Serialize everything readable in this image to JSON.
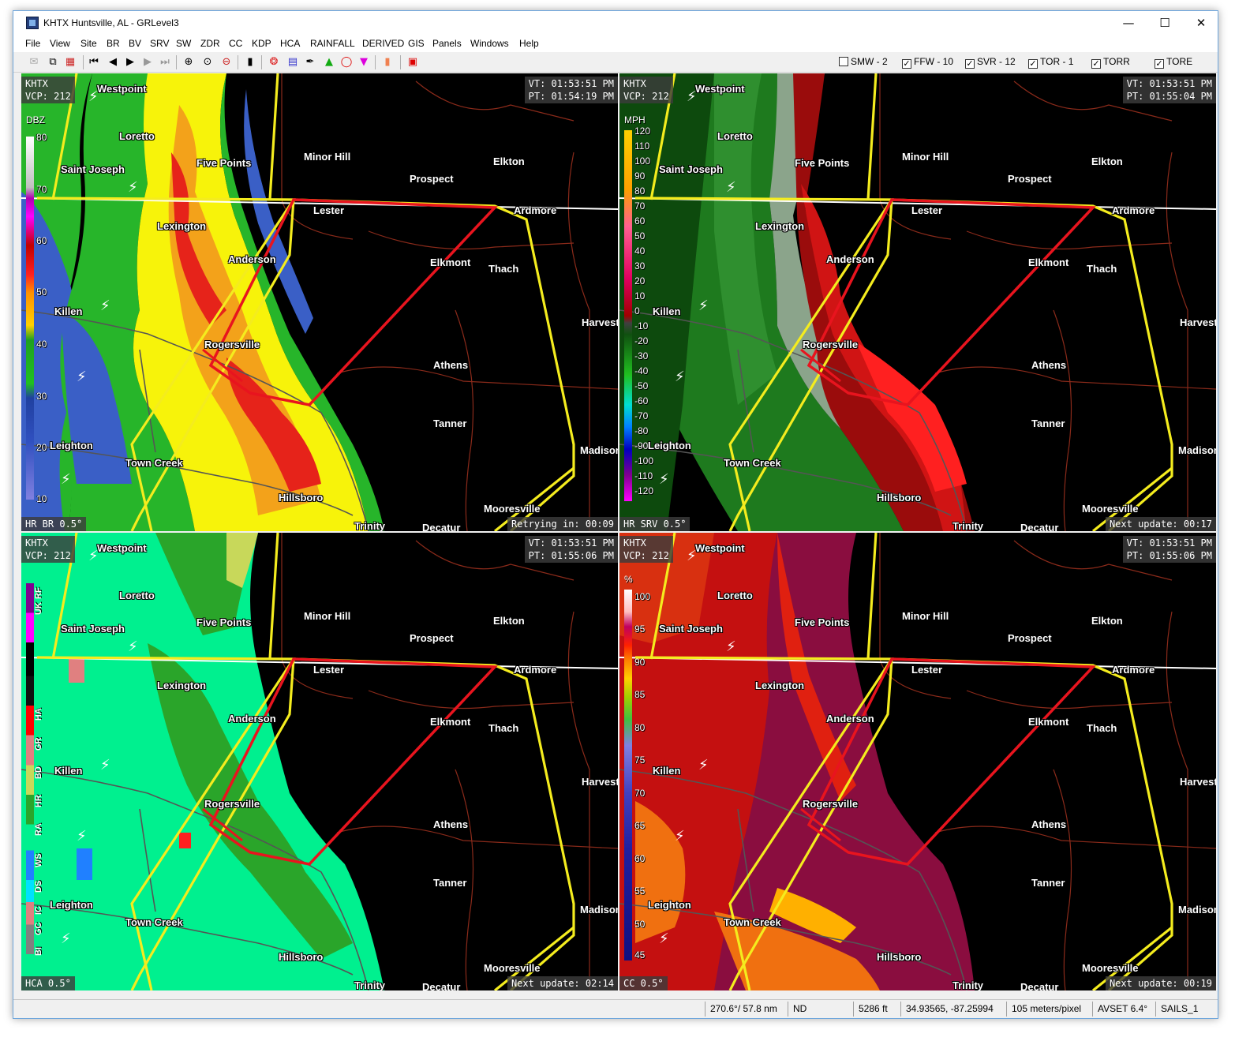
{
  "window": {
    "title": "KHTX Huntsville, AL - GRLevel3"
  },
  "menu": [
    "File",
    "View",
    "Site",
    "BR",
    "BV",
    "SRV",
    "SW",
    "ZDR",
    "CC",
    "KDP",
    "HCA",
    "RAINFALL",
    "DERIVED",
    "GIS",
    "Panels",
    "Windows",
    "Help"
  ],
  "warnings": [
    {
      "label": "SMW - 2",
      "checked": false
    },
    {
      "label": "FFW - 10",
      "checked": true
    },
    {
      "label": "SVR - 12",
      "checked": true
    },
    {
      "label": "TOR - 1",
      "checked": true
    },
    {
      "label": "TORR",
      "checked": true
    },
    {
      "label": "TORE",
      "checked": true
    }
  ],
  "panels": [
    {
      "site": "KHTX",
      "vcp": "VCP: 212",
      "vt": "VT: 01:53:51 PM",
      "pt": "PT: 01:54:19 PM",
      "product": "HR BR 0.5°",
      "status": "Retrying in: 00:09",
      "unit": "DBZ",
      "legend_ticks": [
        "80",
        "70",
        "60",
        "50",
        "40",
        "30",
        "20",
        "10"
      ]
    },
    {
      "site": "KHTX",
      "vcp": "VCP: 212",
      "vt": "VT: 01:53:51 PM",
      "pt": "PT: 01:55:04 PM",
      "product": "HR SRV 0.5°",
      "status": "Next update: 00:17",
      "unit": "MPH",
      "legend_ticks": [
        "120",
        "110",
        "100",
        "90",
        "80",
        "70",
        "60",
        "50",
        "40",
        "30",
        "20",
        "10",
        "0",
        "-10",
        "-20",
        "-30",
        "-40",
        "-50",
        "-60",
        "-70",
        "-80",
        "-90",
        "-100",
        "-110",
        "-120"
      ]
    },
    {
      "site": "KHTX",
      "vcp": "VCP: 212",
      "vt": "VT: 01:53:51 PM",
      "pt": "PT: 01:55:06 PM",
      "product": "HCA 0.5°",
      "status": "Next update: 02:14",
      "unit": "",
      "legend_ticks": [
        "UK",
        "RF",
        "HA",
        "GR",
        "BD",
        "HR",
        "RA",
        "WS",
        "DS",
        "IC",
        "GC",
        "BI"
      ]
    },
    {
      "site": "KHTX",
      "vcp": "VCP: 212",
      "vt": "VT: 01:53:51 PM",
      "pt": "PT: 01:55:06 PM",
      "product": "CC 0.5°",
      "status": "Next update: 00:19",
      "unit": "%",
      "legend_ticks": [
        "100",
        "95",
        "90",
        "85",
        "80",
        "75",
        "70",
        "65",
        "60",
        "55",
        "50",
        "45"
      ]
    }
  ],
  "places": [
    "Westpoint",
    "Loretto",
    "Saint Joseph",
    "Five Points",
    "Minor Hill",
    "Prospect",
    "Elkton",
    "Lester",
    "Ardmore",
    "Lexington",
    "Anderson",
    "Elkmont",
    "Thach",
    "Killen",
    "Rogersville",
    "Athens",
    "Harvest",
    "Tanner",
    "Leighton",
    "Town Creek",
    "Madison",
    "Hillsboro",
    "Mooresville",
    "Trinity",
    "Decatur"
  ],
  "status_bar": {
    "azimuth": "270.6°/ 57.8 nm",
    "value": "ND",
    "height": "5286 ft",
    "latlon": "34.93565, -87.25994",
    "resolution": "105 meters/pixel",
    "avset": "AVSET 6.4°",
    "sails": "SAILS_1"
  },
  "colors": {
    "warning_tor": "#e8141e",
    "warning_svr": "#f4ec1e",
    "ref_blue": "#3a5fc6",
    "ref_green": "#27b52a",
    "ref_yellow": "#f7f30a",
    "ref_red": "#e6231a",
    "hca_rain": "#00f08f",
    "cc_maroon": "#8a0d3f"
  }
}
